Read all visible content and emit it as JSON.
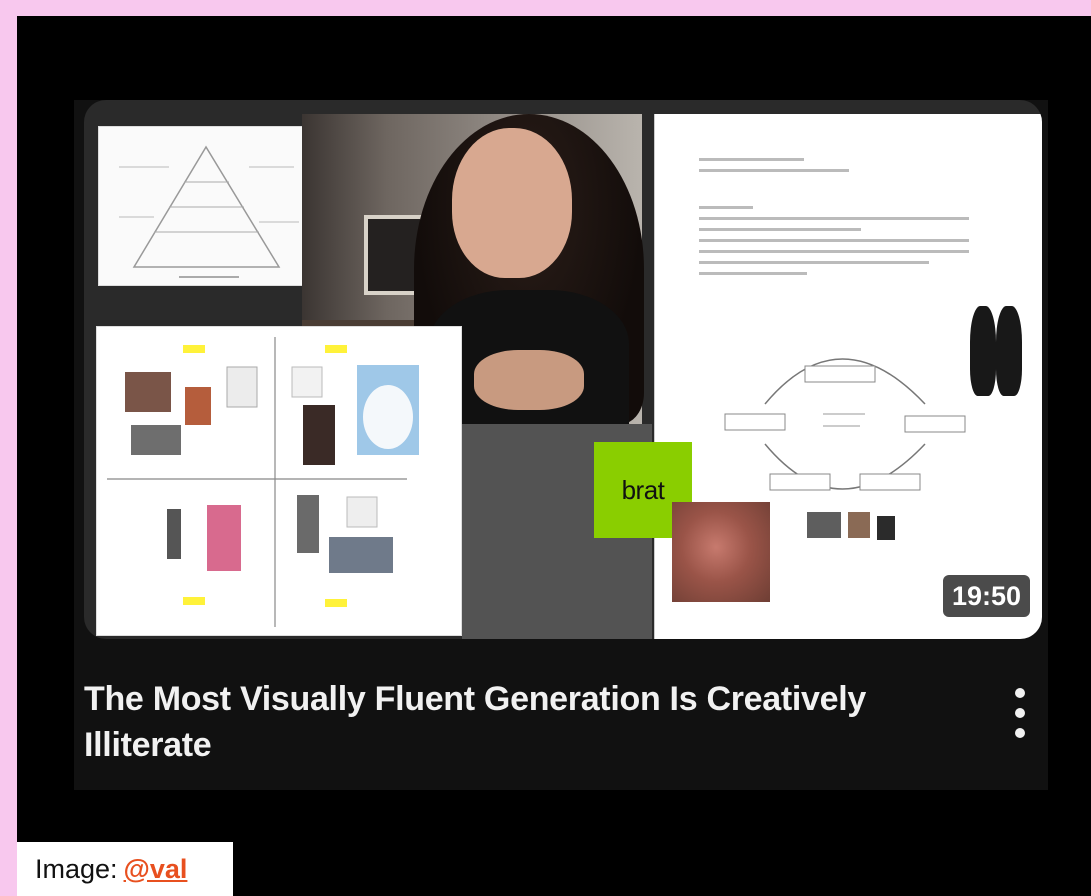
{
  "video": {
    "title": "The Most Visually Fluent Generation Is Creatively Illiterate",
    "duration": "19:50",
    "thumbnail_badge": "brat"
  },
  "credit": {
    "label": "Image:",
    "handle": "@val"
  },
  "icons": {
    "menu": "more-vert-icon"
  },
  "colors": {
    "page_background": "#f8c8ee",
    "screen_background": "#000000",
    "brat_green": "#8ace00",
    "credit_link": "#e8501f"
  }
}
